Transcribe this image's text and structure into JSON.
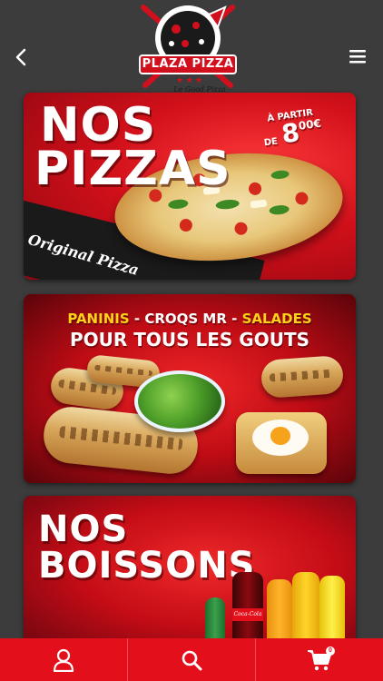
{
  "header": {
    "logo_text": "PLAZA PIZZA",
    "logo_subtext": "Le Good Pizza",
    "back_icon": "chevron-left-icon",
    "menu_icon": "hamburger-icon"
  },
  "banners": [
    {
      "title_line1": "NOS",
      "title_line2": "PIZZAS",
      "price_label_1": "À PARTIR",
      "price_label_2": "DE",
      "price_value": "8",
      "price_cents": "00€",
      "tagline": "Original Pizza"
    },
    {
      "sub_part1": "PANINIS",
      "sub_sep1": " - ",
      "sub_part2": "CROQS MR",
      "sub_sep2": " - ",
      "sub_part3": "SALADES",
      "title": "POUR TOUS LES GOUTS"
    },
    {
      "title_line1": "NOS",
      "title_line2": "BOISSONS",
      "bottle_label": "Coca-Cola"
    }
  ],
  "bottom_nav": {
    "items": [
      {
        "icon": "user-icon"
      },
      {
        "icon": "search-icon"
      },
      {
        "icon": "cart-icon",
        "badge": "0"
      }
    ]
  },
  "colors": {
    "brand_red": "#e3101c",
    "background": "#3c3c3c",
    "accent_yellow": "#ffd21a"
  }
}
